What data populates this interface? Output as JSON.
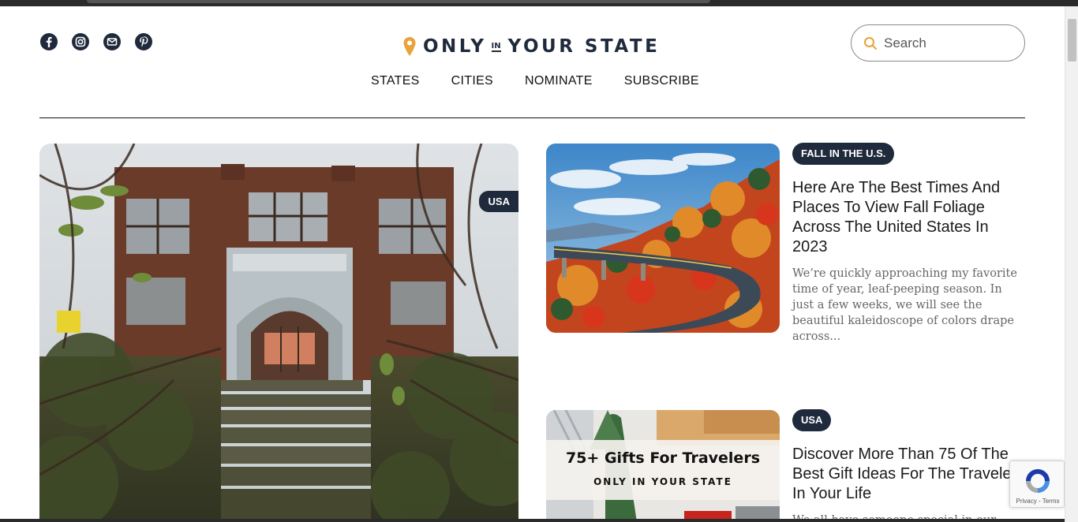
{
  "social": {
    "icons": [
      "facebook-icon",
      "instagram-icon",
      "mail-icon",
      "pinterest-icon"
    ]
  },
  "logo": {
    "word1": "ONLY",
    "word2": "IN",
    "word3": "YOUR STATE"
  },
  "nav": {
    "items": [
      "STATES",
      "CITIES",
      "NOMINATE",
      "SUBSCRIBE"
    ]
  },
  "search": {
    "placeholder": "Search"
  },
  "hero": {
    "badge": "USA"
  },
  "articles": [
    {
      "tag": "FALL IN THE U.S.",
      "title": "Here Are The Best Times And Places To View Fall Foliage Across The United States In 2023",
      "excerpt": "We’re quickly approaching my favorite time of year, leaf-peeping season. In just a few weeks, we will see the beautiful kaleidoscope of colors drape across..."
    },
    {
      "tag": "USA",
      "title": "Discover More Than 75 Of The Best Gift Ideas For The Traveler In Your Life",
      "excerpt": "We all have someone special in our",
      "image_text": "75+ Gifts For Travelers",
      "image_logo": "ONLY IN YOUR STATE"
    }
  ],
  "recaptcha": {
    "text": "Privacy - Terms"
  },
  "colors": {
    "brand_navy": "#1f2a3c",
    "pin_orange": "#e8a33a"
  }
}
